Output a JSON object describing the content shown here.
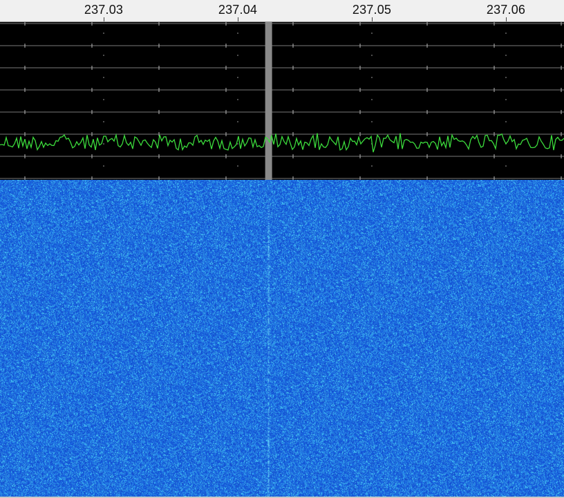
{
  "frequency_scale": {
    "labels": [
      "237.03",
      "237.04",
      "237.05",
      "237.06"
    ],
    "values_mhz": [
      237.03,
      237.04,
      237.05,
      237.06
    ]
  },
  "tuning": {
    "center_frequency_mhz": 237.0423,
    "marker_color": "#2ecc40",
    "band_color": "#8a8a8a"
  },
  "spectrum": {
    "background_color": "#000000",
    "trace_color": "#3cdc3c",
    "grid_color": "#7a7a7a"
  },
  "waterfall": {
    "base_color": "#1d63d8",
    "signal_color": "#7fe8ff"
  }
}
